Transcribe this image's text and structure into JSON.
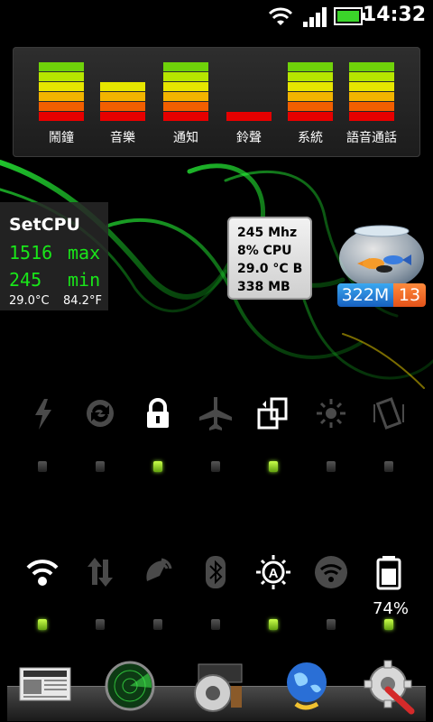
{
  "status_bar": {
    "time": "14:32",
    "icons": [
      "wifi-icon",
      "signal-icon",
      "battery-icon"
    ]
  },
  "volume_widget": {
    "channels": [
      {
        "label": "鬧鐘",
        "level": 1.0
      },
      {
        "label": "音樂",
        "level": 0.66
      },
      {
        "label": "通知",
        "level": 1.0
      },
      {
        "label": "鈴聲",
        "level": 0.17
      },
      {
        "label": "系統",
        "level": 1.0
      },
      {
        "label": "語音通話",
        "level": 1.0
      }
    ]
  },
  "setcpu": {
    "title": "SetCPU",
    "max_value": "1516",
    "max_label": "max",
    "min_value": "245",
    "min_label": "min",
    "temp_c": "29.0°C",
    "temp_f": "84.2°F"
  },
  "cpu_info": {
    "freq": "245 Mhz",
    "usage": "8% CPU",
    "temp": "29.0 °C B",
    "memory": "338 MB"
  },
  "memory_widget": {
    "free": "322M",
    "count": "13"
  },
  "toggles_row1": [
    {
      "name": "flashlight-icon",
      "on": false
    },
    {
      "name": "sync-icon",
      "on": false
    },
    {
      "name": "lock-icon",
      "on": true
    },
    {
      "name": "airplane-mode-icon",
      "on": false
    },
    {
      "name": "auto-rotate-icon",
      "on": true
    },
    {
      "name": "brightness-icon",
      "on": false
    },
    {
      "name": "vibrate-icon",
      "on": false
    }
  ],
  "toggles_row2": [
    {
      "name": "wifi-toggle-icon",
      "on": true
    },
    {
      "name": "mobile-data-icon",
      "on": false
    },
    {
      "name": "gps-icon",
      "on": false
    },
    {
      "name": "bluetooth-icon",
      "on": false
    },
    {
      "name": "auto-brightness-icon",
      "on": true
    },
    {
      "name": "wifi-hotspot-icon",
      "on": false
    },
    {
      "name": "battery-toggle-icon",
      "on": true
    }
  ],
  "battery_percent": "74%",
  "dock_apps": [
    "news-app-icon",
    "radar-app-icon",
    "media-app-icon",
    "browser-app-icon",
    "settings-app-icon"
  ],
  "colors": {
    "led_on": "#8fdc2a",
    "setcpu_green": "#19e619",
    "mem_blue": "#1760c0",
    "mem_orange": "#e4531a"
  }
}
